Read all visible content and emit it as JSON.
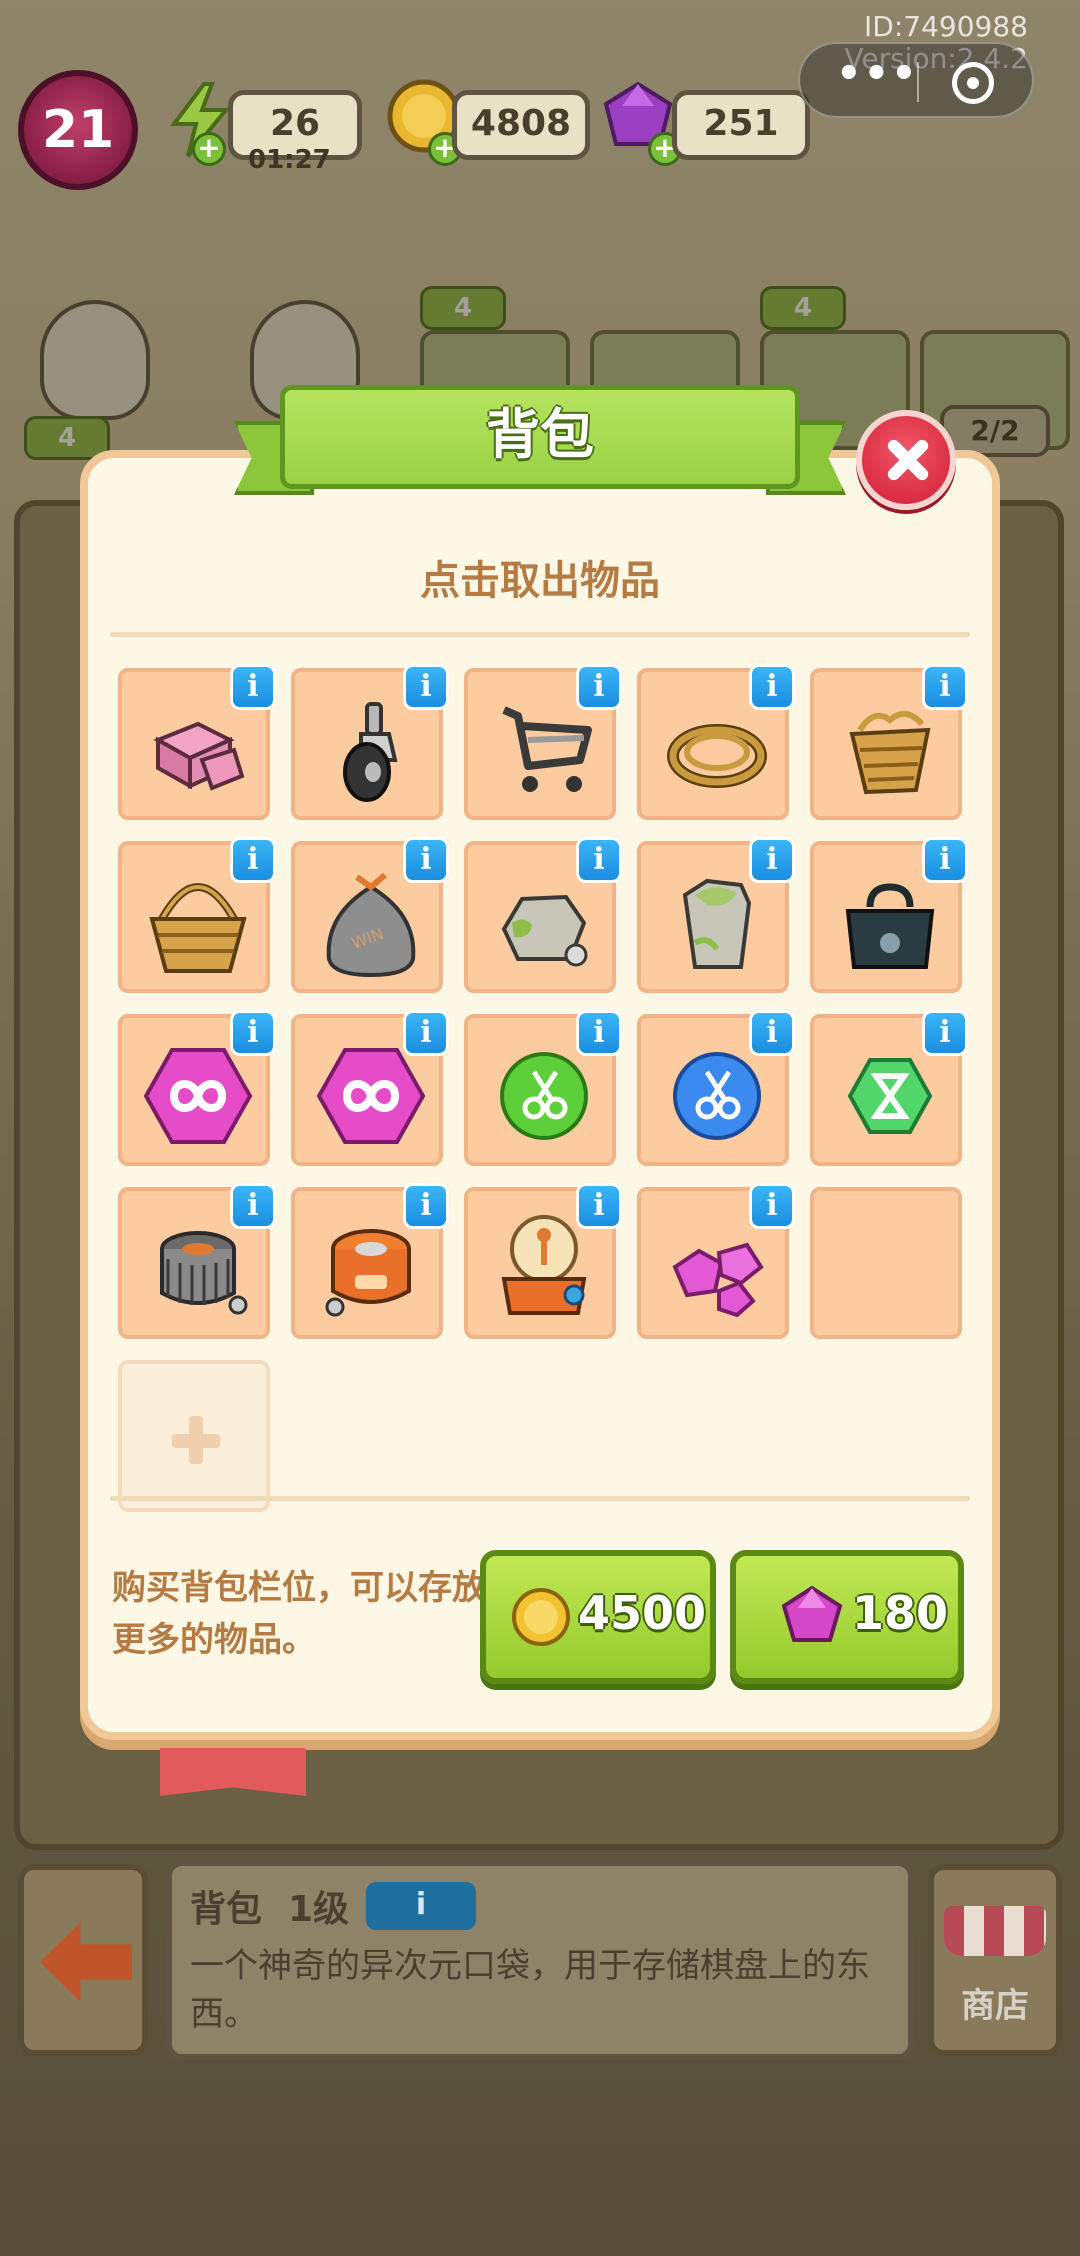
{
  "overlay": {
    "id_text": "ID:7490988",
    "version_text": "Version:2.4.2",
    "more_glyph": "•••"
  },
  "hud": {
    "level": "21",
    "energy": "26",
    "energy_timer": "01:27",
    "coins": "4808",
    "gems": "251"
  },
  "background": {
    "badges": [
      "4",
      "4",
      "4"
    ],
    "counters": [
      "2/2"
    ]
  },
  "modal": {
    "title": "背包",
    "subtitle": "点击取出物品",
    "info_glyph": "i",
    "items": [
      {
        "name": "pink-bricks",
        "info": true
      },
      {
        "name": "caster-wheel",
        "info": true
      },
      {
        "name": "shopping-cart",
        "info": true
      },
      {
        "name": "rope-coil",
        "info": true
      },
      {
        "name": "broken-basket",
        "info": true
      },
      {
        "name": "wicker-basket",
        "info": true
      },
      {
        "name": "garbage-sack",
        "info": true
      },
      {
        "name": "mossy-rock",
        "info": true
      },
      {
        "name": "mossy-pillar",
        "info": true
      },
      {
        "name": "black-bag",
        "info": true
      },
      {
        "name": "pink-infinity-hex",
        "info": true
      },
      {
        "name": "pink-infinity-hex",
        "info": true
      },
      {
        "name": "green-scissors-orb",
        "info": true
      },
      {
        "name": "blue-scissors-orb",
        "info": true
      },
      {
        "name": "green-hourglass-hex",
        "info": true
      },
      {
        "name": "gray-drum-machine",
        "info": true
      },
      {
        "name": "orange-drum-machine",
        "info": true
      },
      {
        "name": "plasma-ball-machine",
        "info": true
      },
      {
        "name": "pink-gems",
        "info": true
      },
      {
        "name": "",
        "info": false
      }
    ],
    "buy_text": "购买背包栏位，可以存放更多的物品。",
    "buy_coin_price": "4500",
    "buy_gem_price": "180"
  },
  "bottom": {
    "item_name": "背包",
    "item_level": "1级",
    "info_pill": "i",
    "description": "一个神奇的异次元口袋，用于存储棋盘上的东西。",
    "shop_label": "商店"
  },
  "colors": {
    "modal_bg": "#fdf8e6",
    "cell_bg": "#fdcba0",
    "ribbon_green": "#9ad246",
    "info_blue": "#1a8ee0",
    "close_red": "#d8283e",
    "text_brown": "#b57b42"
  }
}
